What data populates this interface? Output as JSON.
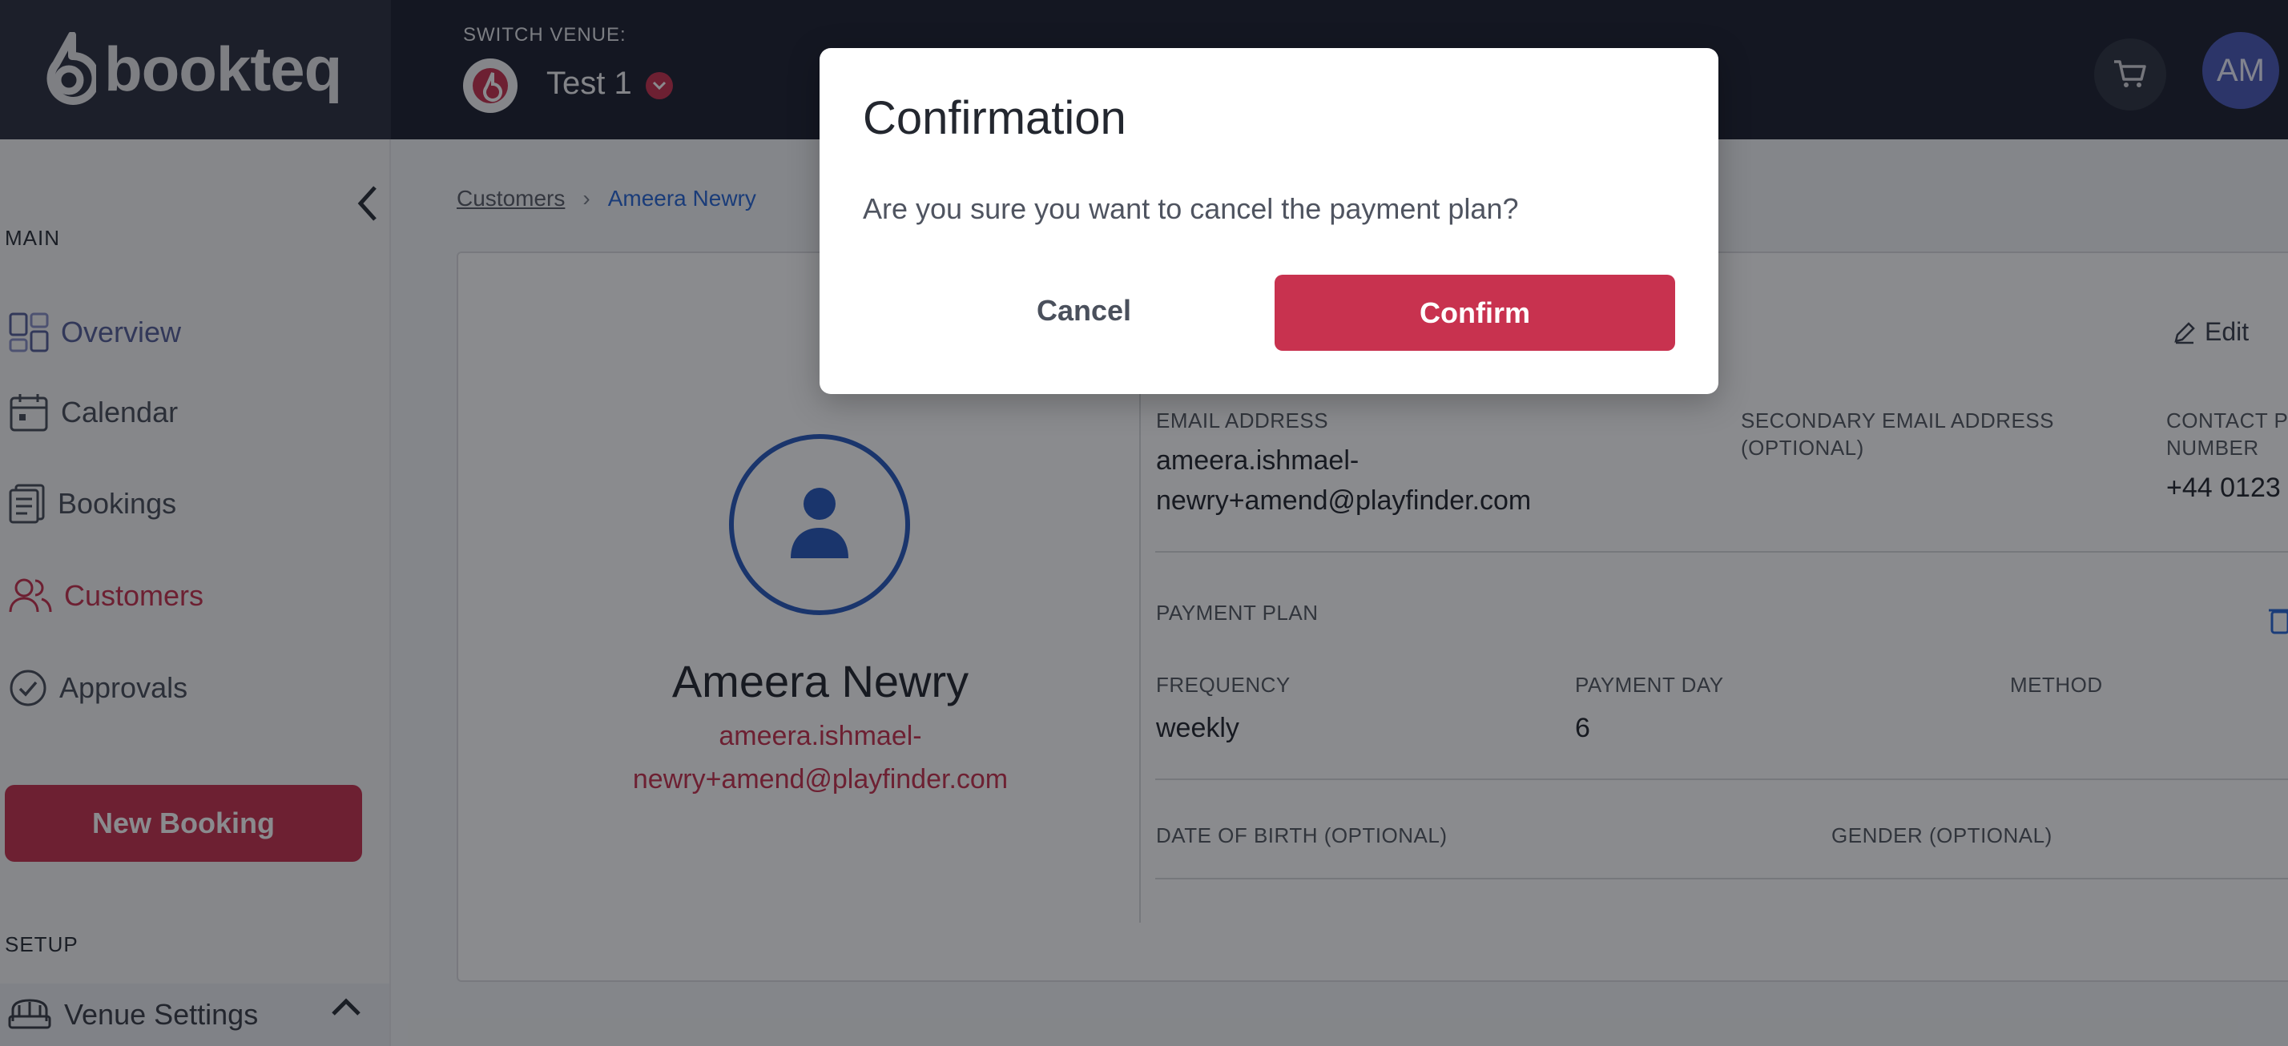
{
  "brand": {
    "name": "bookteq"
  },
  "venue": {
    "switch_label": "SWITCH VENUE:",
    "name": "Test 1"
  },
  "header": {
    "avatar_initials": "AM",
    "cart_icon": "cart-icon"
  },
  "sidebar": {
    "main_label": "MAIN",
    "items": [
      {
        "label": "Overview",
        "icon": "overview-icon"
      },
      {
        "label": "Calendar",
        "icon": "calendar-icon"
      },
      {
        "label": "Bookings",
        "icon": "bookings-icon"
      },
      {
        "label": "Customers",
        "icon": "customers-icon",
        "active": true
      },
      {
        "label": "Approvals",
        "icon": "approvals-icon"
      }
    ],
    "new_booking_label": "New Booking",
    "setup_label": "SETUP",
    "venue_settings_label": "Venue Settings"
  },
  "breadcrumb": {
    "parent": "Customers",
    "separator": "›",
    "current": "Ameera Newry"
  },
  "customer": {
    "name": "Ameera Newry",
    "email_display": "ameera.ishmael-newry+amend@playfinder.com",
    "edit_label": "Edit",
    "fields": {
      "email_label": "EMAIL ADDRESS",
      "email_value": "ameera.ishmael-newry+amend@playfinder.com",
      "secondary_email_label": "SECONDARY EMAIL ADDRESS (OPTIONAL)",
      "contact_label": "CONTACT P NUMBER",
      "contact_value": "+44 0123"
    },
    "payment_plan": {
      "label": "PAYMENT PLAN",
      "frequency_label": "FREQUENCY",
      "frequency_value": "weekly",
      "payment_day_label": "PAYMENT DAY",
      "payment_day_value": "6",
      "method_label": "METHOD"
    },
    "dob_label": "DATE OF BIRTH (OPTIONAL)",
    "gender_label": "GENDER (OPTIONAL)"
  },
  "modal": {
    "title": "Confirmation",
    "message": "Are you sure you want to cancel the payment plan?",
    "cancel_label": "Cancel",
    "confirm_label": "Confirm"
  },
  "colors": {
    "accent": "#c8324f",
    "link": "#2a69d6",
    "topbar": "#1d2230"
  }
}
